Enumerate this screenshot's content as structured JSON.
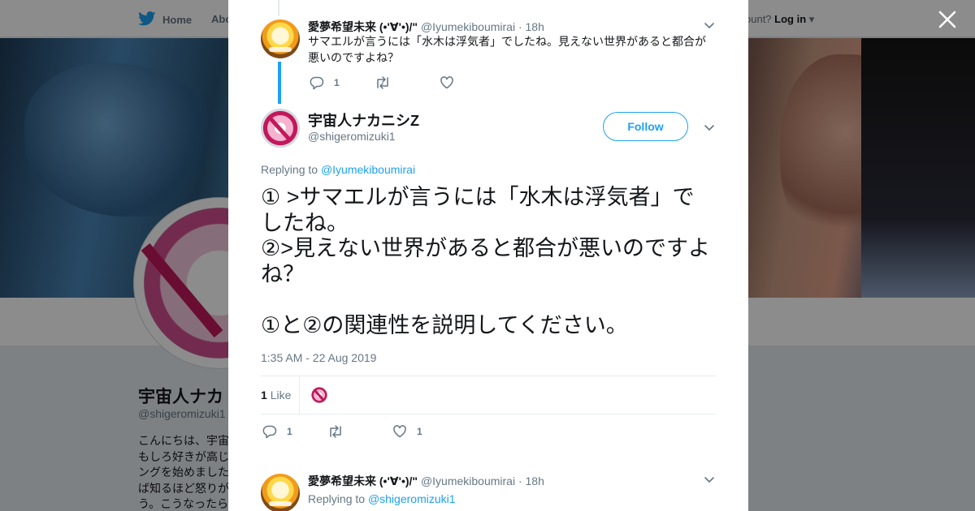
{
  "topnav": {
    "home_label": "Home",
    "about_label": "Abo",
    "account_prompt": "ccount?",
    "login_label": "Log in"
  },
  "profile": {
    "name": "宇宙人ナカ",
    "handle": "@shigeromizuki1",
    "bio_lines": [
      "こんにちは、宇宙",
      "もしろ好きが高じ",
      "ングを始めました",
      "ば知るほど怒りが",
      "う。こうなったら"
    ]
  },
  "ancestor_tweet": {
    "name": "愛夢希望未来 (•'∀'•)/\"",
    "handle": "@Iyumekiboumirai",
    "time": "· 18h",
    "text": "サマエルが言うには「水木は浮気者」でしたね。見えない世界があると都合が悪いのですよね？",
    "reply_count": "1",
    "retweet_count": "",
    "like_count": ""
  },
  "main_tweet": {
    "name": "宇宙人ナカニシZ",
    "handle": "@shigeromizuki1",
    "follow_label": "Follow",
    "replying_prefix": "Replying to ",
    "replying_to": "@Iyumekiboumirai",
    "text_paragraphs": [
      "① >サマエルが言うには「水木は浮気者」でしたね。\n②>見えない世界があると都合が悪いのですよね？",
      "①と②の関連性を説明してください。"
    ],
    "timestamp": "1:35 AM - 22 Aug 2019",
    "like_count": "1",
    "like_label": "Like",
    "reply_count": "1",
    "retweet_count": "",
    "heart_count": "1"
  },
  "reply_tweet": {
    "name": "愛夢希望未来 (•'∀'•)/\"",
    "handle": "@Iyumekiboumirai",
    "time": "· 18h",
    "replying_prefix": "Replying to ",
    "replying_to": "@shigeromizuki1"
  },
  "colors": {
    "accent": "#1da1f2",
    "text": "#14171a",
    "muted": "#657786",
    "overlay": "rgba(0,0,0,0.45)"
  }
}
